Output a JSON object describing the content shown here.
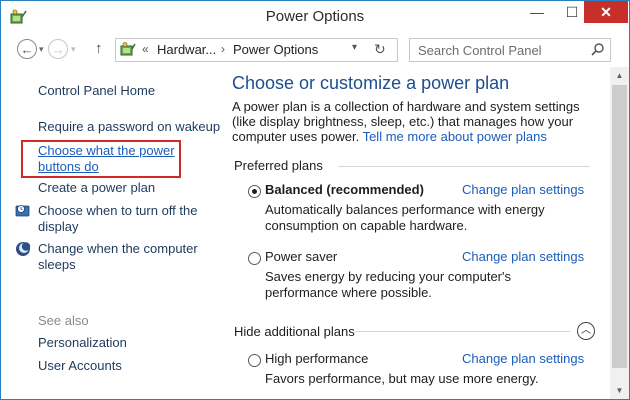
{
  "window": {
    "title": "Power Options",
    "minimize_glyph": "—",
    "maximize_glyph": "☐",
    "close_glyph": "✕"
  },
  "nav": {
    "back_glyph": "←",
    "forward_glyph": "→",
    "up_glyph": "↑",
    "address": {
      "chevrons": "«",
      "crumb_1": "Hardwar...",
      "separator": "›",
      "crumb_2": "Power Options"
    },
    "search_placeholder": "Search Control Panel"
  },
  "sidebar": {
    "items": [
      {
        "label": "Control Panel Home"
      },
      {
        "label": "Require a password on wakeup"
      },
      {
        "label_line1": "Choose what the power",
        "label_line2": "buttons do"
      },
      {
        "label": "Create a power plan"
      },
      {
        "label_line1": "Choose when to turn off the",
        "label_line2": "display"
      },
      {
        "label_line1": "Change when the computer",
        "label_line2": "sleeps"
      }
    ],
    "see_also_heading": "See also",
    "see_also": [
      {
        "label": "Personalization"
      },
      {
        "label": "User Accounts"
      }
    ]
  },
  "main": {
    "heading": "Choose or customize a power plan",
    "intro": "A power plan is a collection of hardware and system settings (like display brightness, sleep, etc.) that manages how your computer uses power.",
    "intro_link": "Tell me more about power plans",
    "preferred_heading": "Preferred plans",
    "hidden_heading": "Hide additional plans",
    "plans": [
      {
        "name": "Balanced (recommended)",
        "selected": true,
        "link": "Change plan settings",
        "desc": "Automatically balances performance with energy consumption on capable hardware."
      },
      {
        "name": "Power saver",
        "selected": false,
        "link": "Change plan settings",
        "desc": "Saves energy by reducing your computer's performance where possible."
      },
      {
        "name": "High performance",
        "selected": false,
        "link": "Change plan settings",
        "desc": "Favors performance, but may use more energy."
      }
    ]
  },
  "colors": {
    "link": "#1a5dbd",
    "heading": "#1e4e8c",
    "highlight_border": "#cf2a2a",
    "close_button": "#c7302a"
  }
}
